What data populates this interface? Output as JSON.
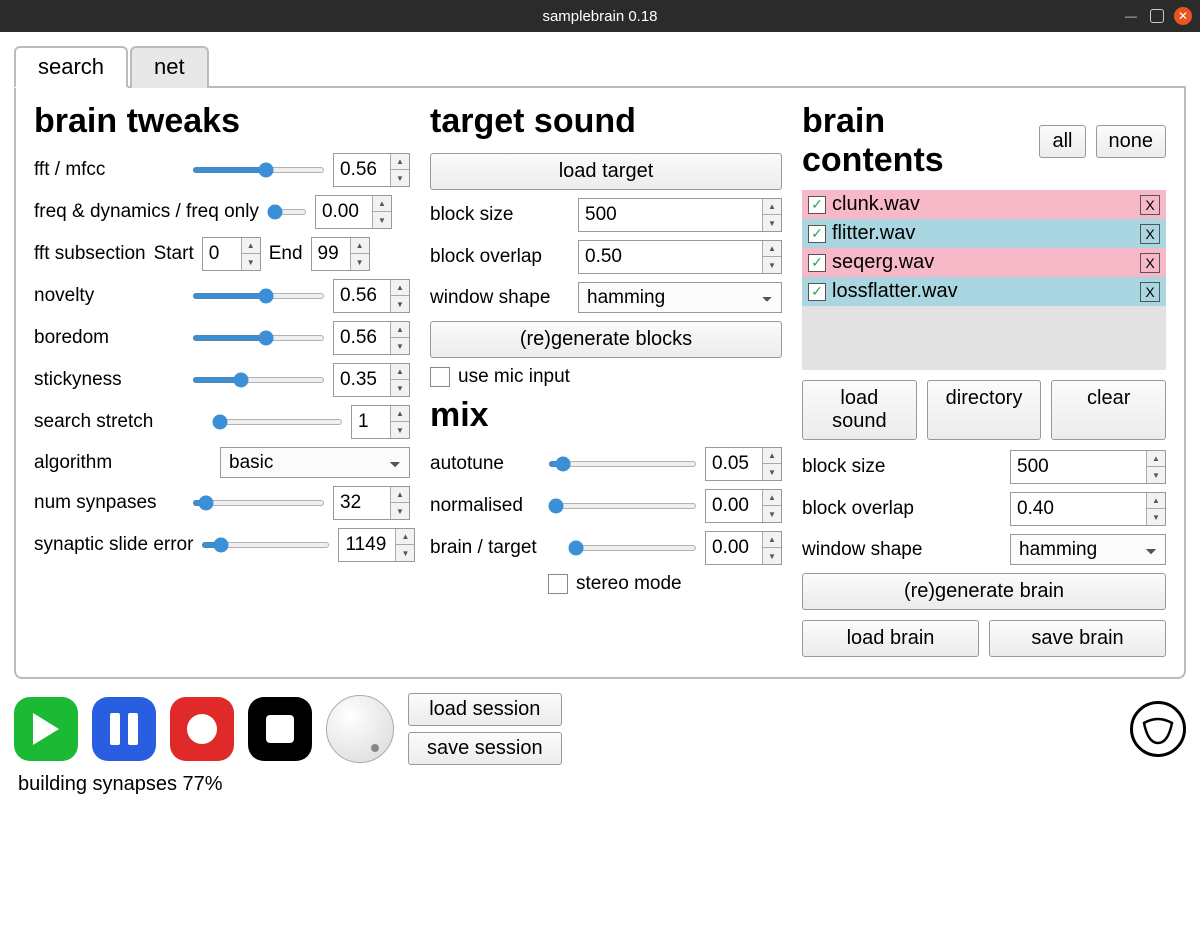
{
  "window": {
    "title": "samplebrain 0.18"
  },
  "tabs": [
    {
      "label": "search",
      "active": true
    },
    {
      "label": "net",
      "active": false
    }
  ],
  "brain_tweaks": {
    "heading": "brain tweaks",
    "fft_mfcc": {
      "label": "fft / mfcc",
      "value": "0.56",
      "slider": 0.56
    },
    "freq_dyn": {
      "label": "freq & dynamics / freq only",
      "value": "0.00",
      "slider": 0.0
    },
    "fft_subsection": {
      "label": "fft subsection",
      "start_label": "Start",
      "start": "0",
      "end_label": "End",
      "end": "99"
    },
    "novelty": {
      "label": "novelty",
      "value": "0.56",
      "slider": 0.56
    },
    "boredom": {
      "label": "boredom",
      "value": "0.56",
      "slider": 0.56
    },
    "stickyness": {
      "label": "stickyness",
      "value": "0.35",
      "slider": 0.35
    },
    "search_stretch": {
      "label": "search stretch",
      "value": "1",
      "slider": 0.0
    },
    "algorithm": {
      "label": "algorithm",
      "value": "basic"
    },
    "num_synapses": {
      "label": "num synpases",
      "value": "32",
      "slider": 0.05
    },
    "slide_error": {
      "label": "synaptic slide error",
      "value": "1149",
      "slider": 0.1
    }
  },
  "target_sound": {
    "heading": "target sound",
    "load_target": "load target",
    "block_size": {
      "label": "block size",
      "value": "500"
    },
    "block_overlap": {
      "label": "block overlap",
      "value": "0.50"
    },
    "window_shape": {
      "label": "window shape",
      "value": "hamming"
    },
    "regenerate": "(re)generate blocks",
    "use_mic": {
      "label": "use mic input",
      "checked": false
    }
  },
  "mix": {
    "heading": "mix",
    "autotune": {
      "label": "autotune",
      "value": "0.05",
      "slider": 0.05
    },
    "normalised": {
      "label": "normalised",
      "value": "0.00",
      "slider": 0.0
    },
    "brain_target": {
      "label": "brain / target",
      "value": "0.00",
      "slider": 0.0
    },
    "stereo": {
      "label": "stereo mode",
      "checked": false
    }
  },
  "brain_contents": {
    "heading": "brain contents",
    "all": "all",
    "none": "none",
    "files": [
      {
        "name": "clunk.wav",
        "checked": true,
        "color": "pink"
      },
      {
        "name": "flitter.wav",
        "checked": true,
        "color": "blue"
      },
      {
        "name": "seqerg.wav",
        "checked": true,
        "color": "pink"
      },
      {
        "name": "lossflatter.wav",
        "checked": true,
        "color": "blue"
      }
    ],
    "load_sound": "load sound",
    "directory": "directory",
    "clear": "clear",
    "block_size": {
      "label": "block size",
      "value": "500"
    },
    "block_overlap": {
      "label": "block overlap",
      "value": "0.40"
    },
    "window_shape": {
      "label": "window shape",
      "value": "hamming"
    },
    "regenerate": "(re)generate brain",
    "load_brain": "load brain",
    "save_brain": "save brain"
  },
  "session": {
    "load": "load session",
    "save": "save session"
  },
  "status": "building synapses 77%"
}
